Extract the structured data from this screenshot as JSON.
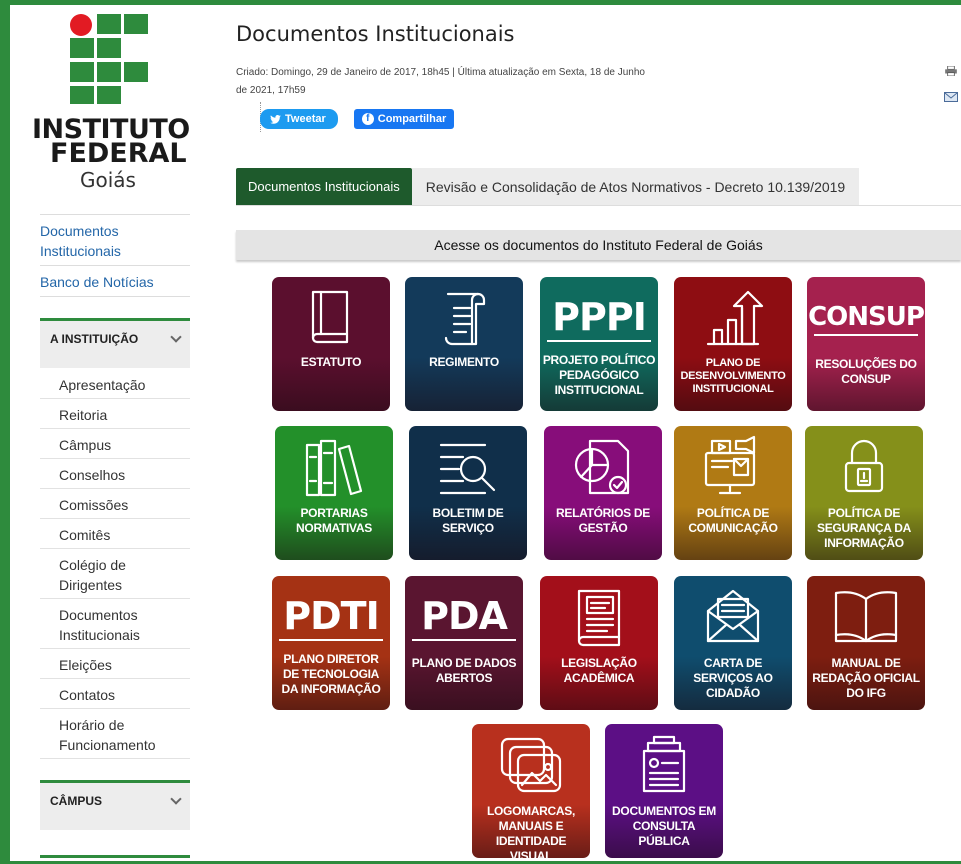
{
  "logo": {
    "line1": "INSTITUTO",
    "line2": "FEDERAL",
    "line3": "Goiás"
  },
  "sidebar": {
    "links": [
      "Documentos Institucionais",
      "Banco de Notícias"
    ],
    "section1": {
      "title": "A INSTITUIÇÃO",
      "items": [
        "Apresentação",
        "Reitoria",
        "Câmpus",
        "Conselhos",
        "Comissões",
        "Comitês",
        "Colégio de Dirigentes",
        "Documentos Institucionais",
        "Eleições",
        "Contatos",
        "Horário de Funcionamento"
      ]
    },
    "section2": {
      "title": "CÂMPUS"
    }
  },
  "page": {
    "title": "Documentos Institucionais",
    "meta": "Criado: Domingo, 29 de Janeiro de 2017, 18h45 | Última atualização em Sexta, 18 de Junho de 2021, 17h59",
    "tweet": "Tweetar",
    "share": "Compartilhar",
    "tabs": [
      "Documentos Institucionais",
      "Revisão e Consolidação de Atos Normativos - Decreto 10.139/2019"
    ],
    "section_title": "Acesse os documentos do Instituto Federal de Goiás"
  },
  "tiles": [
    {
      "label": "ESTATUTO",
      "color": "#5b0f2e",
      "icon": "book-icon"
    },
    {
      "label": "REGIMENTO",
      "color": "#133a5a",
      "icon": "scroll-icon"
    },
    {
      "label": "PROJETO POLÍTICO PEDAGÓGICO INSTITUCIONAL",
      "color": "#0f6b5e",
      "icon": "pppi-text",
      "big": "PPPI"
    },
    {
      "label": "PLANO DE DESENVOLVIMENTO INSTITUCIONAL",
      "color": "#8e0d12",
      "icon": "growth-chart-icon",
      "small": true
    },
    {
      "label": "RESOLUÇÕES DO CONSUP",
      "color": "#a5214e",
      "icon": "consup-text",
      "big": "CONSUP"
    },
    {
      "label": "PORTARIAS NORMATIVAS",
      "color": "#23902a",
      "icon": "binders-icon"
    },
    {
      "label": "BOLETIM DE SERVIÇO",
      "color": "#102f4a",
      "icon": "magnifier-doc-icon"
    },
    {
      "label": "RELATÓRIOS DE GESTÃO",
      "color": "#870d7a",
      "icon": "pie-report-icon"
    },
    {
      "label": "POLÍTICA DE COMUNICAÇÃO",
      "color": "#b07a14",
      "icon": "media-icon"
    },
    {
      "label": "POLÍTICA DE SEGURANÇA DA INFORMAÇÃO",
      "color": "#85901a",
      "icon": "padlock-icon"
    },
    {
      "label": "PLANO DIRETOR DE TECNOLOGIA DA INFORMAÇÃO",
      "color": "#a53214",
      "icon": "pdti-text",
      "big": "PDTI"
    },
    {
      "label": "PLANO DE DADOS ABERTOS",
      "color": "#5a1530",
      "icon": "pda-text",
      "big": "PDA"
    },
    {
      "label": "LEGISLAÇÃO ACADÊMICA",
      "color": "#a30f1a",
      "icon": "law-book-icon"
    },
    {
      "label": "CARTA DE SERVIÇOS AO CIDADÃO",
      "color": "#0f4d6e",
      "icon": "envelope-icon"
    },
    {
      "label": "MANUAL DE REDAÇÃO OFICIAL DO IFG",
      "color": "#7e1e10",
      "icon": "open-book-icon"
    },
    {
      "label": "LOGOMARCAS, MANUAIS E IDENTIDADE VISUAL",
      "color": "#b8301e",
      "icon": "images-icon"
    },
    {
      "label": "DOCUMENTOS EM CONSULTA PÚBLICA",
      "color": "#5c0f85",
      "icon": "doc-stack-icon"
    }
  ]
}
